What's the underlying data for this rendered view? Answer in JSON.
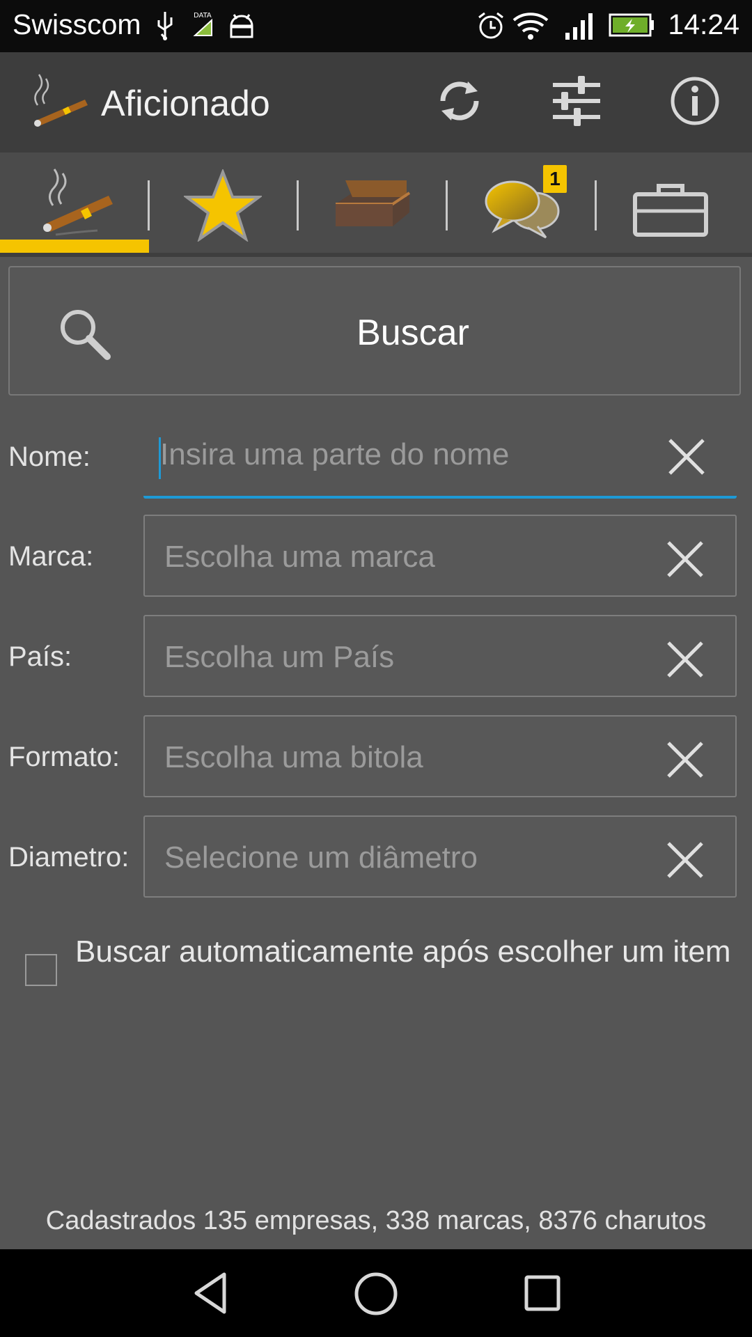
{
  "status_bar": {
    "carrier": "Swisscom",
    "time": "14:24",
    "icons": [
      "usb-icon",
      "data-icon",
      "android-icon",
      "alarm-icon",
      "wifi-icon",
      "signal-icon",
      "battery-charging-icon"
    ]
  },
  "action_bar": {
    "title": "Aficionado",
    "actions": [
      "sync-icon",
      "filter-sliders-icon",
      "info-icon"
    ]
  },
  "tabs": [
    {
      "name": "cigar-tab",
      "icon": "cigar-icon",
      "selected": true
    },
    {
      "name": "favorites-tab",
      "icon": "star-icon"
    },
    {
      "name": "humidor-tab",
      "icon": "humidor-box-icon"
    },
    {
      "name": "messages-tab",
      "icon": "chat-bubbles-icon",
      "badge": "1"
    },
    {
      "name": "briefcase-tab",
      "icon": "briefcase-icon"
    }
  ],
  "search": {
    "label": "Buscar"
  },
  "form": {
    "nome": {
      "label": "Nome:",
      "placeholder": "Insira uma parte do nome"
    },
    "marca": {
      "label": "Marca:",
      "placeholder": "Escolha uma marca"
    },
    "pais": {
      "label": "País:",
      "placeholder": "Escolha um País"
    },
    "formato": {
      "label": "Formato:",
      "placeholder": "Escolha uma bitola"
    },
    "diametro": {
      "label": "Diametro:",
      "placeholder": "Selecione um diâmetro"
    }
  },
  "auto_search": {
    "label": "Buscar automaticamente após escolher um item",
    "checked": false
  },
  "footer": "Cadastrados 135 empresas, 338 marcas, 8376 charutos",
  "colors": {
    "accent": "#f5c400",
    "focus": "#1e9ad6",
    "background": "#555555",
    "action_bar": "#3d3d3d"
  }
}
